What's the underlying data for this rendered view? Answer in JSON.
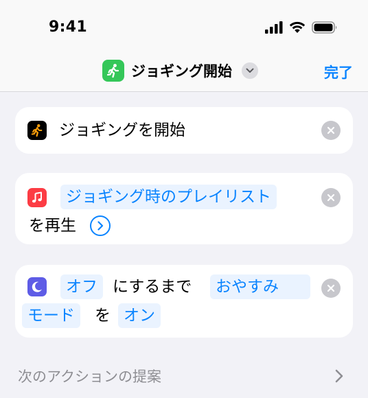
{
  "status": {
    "time": "9:41",
    "icons": [
      "cellular-signal-icon",
      "wifi-icon",
      "battery-icon"
    ]
  },
  "nav": {
    "app_icon": "runner-icon",
    "title": "ジョギング開始",
    "chevron_icon": "chevron-down-icon",
    "done_label": "完了"
  },
  "actions": [
    {
      "icon": "runner-icon",
      "icon_color": "#000000",
      "text": "ジョギングを開始"
    },
    {
      "icon": "music-note-icon",
      "icon_color": "#fc3c44",
      "token": "ジョギング時のプレイリスト",
      "text": "を再生"
    },
    {
      "icon": "moon-icon",
      "icon_color": "#5e5ce6",
      "token_off": "オフ",
      "text_mid": "にするまで",
      "token_mode_a": "おやすみ",
      "token_mode_b": "モード",
      "text_wo": "を",
      "token_on": "オン"
    }
  ],
  "suggestions": {
    "label": "次のアクションの提案"
  },
  "colors": {
    "accent": "#0a84ff",
    "background": "#f2f2f7",
    "card": "#ffffff",
    "token_bg": "#eaf3ff",
    "muted": "#8e8e93"
  }
}
